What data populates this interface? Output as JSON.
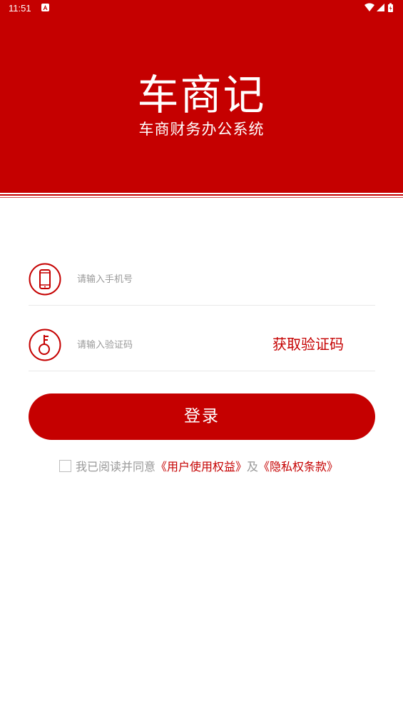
{
  "status_bar": {
    "time": "11:51",
    "icons": [
      "app-notification-icon",
      "wifi-icon",
      "cell-signal-icon",
      "battery-icon"
    ]
  },
  "header": {
    "title": "车商记",
    "subtitle": "车商财务办公系统"
  },
  "form": {
    "phone": {
      "icon": "phone-icon",
      "placeholder": "请输入手机号",
      "value": ""
    },
    "code": {
      "icon": "key-icon",
      "placeholder": "请输入验证码",
      "value": "",
      "get_code_label": "获取验证码"
    },
    "login_label": "登录"
  },
  "agreement": {
    "checked": false,
    "prefix": "我已阅读并同意",
    "user_rights_link": "《用户使用权益》",
    "conjunction": "及",
    "privacy_link": "《隐私权条款》"
  },
  "colors": {
    "brand_red": "#c50000",
    "placeholder_gray": "#999999",
    "divider": "#e8e8e8"
  }
}
